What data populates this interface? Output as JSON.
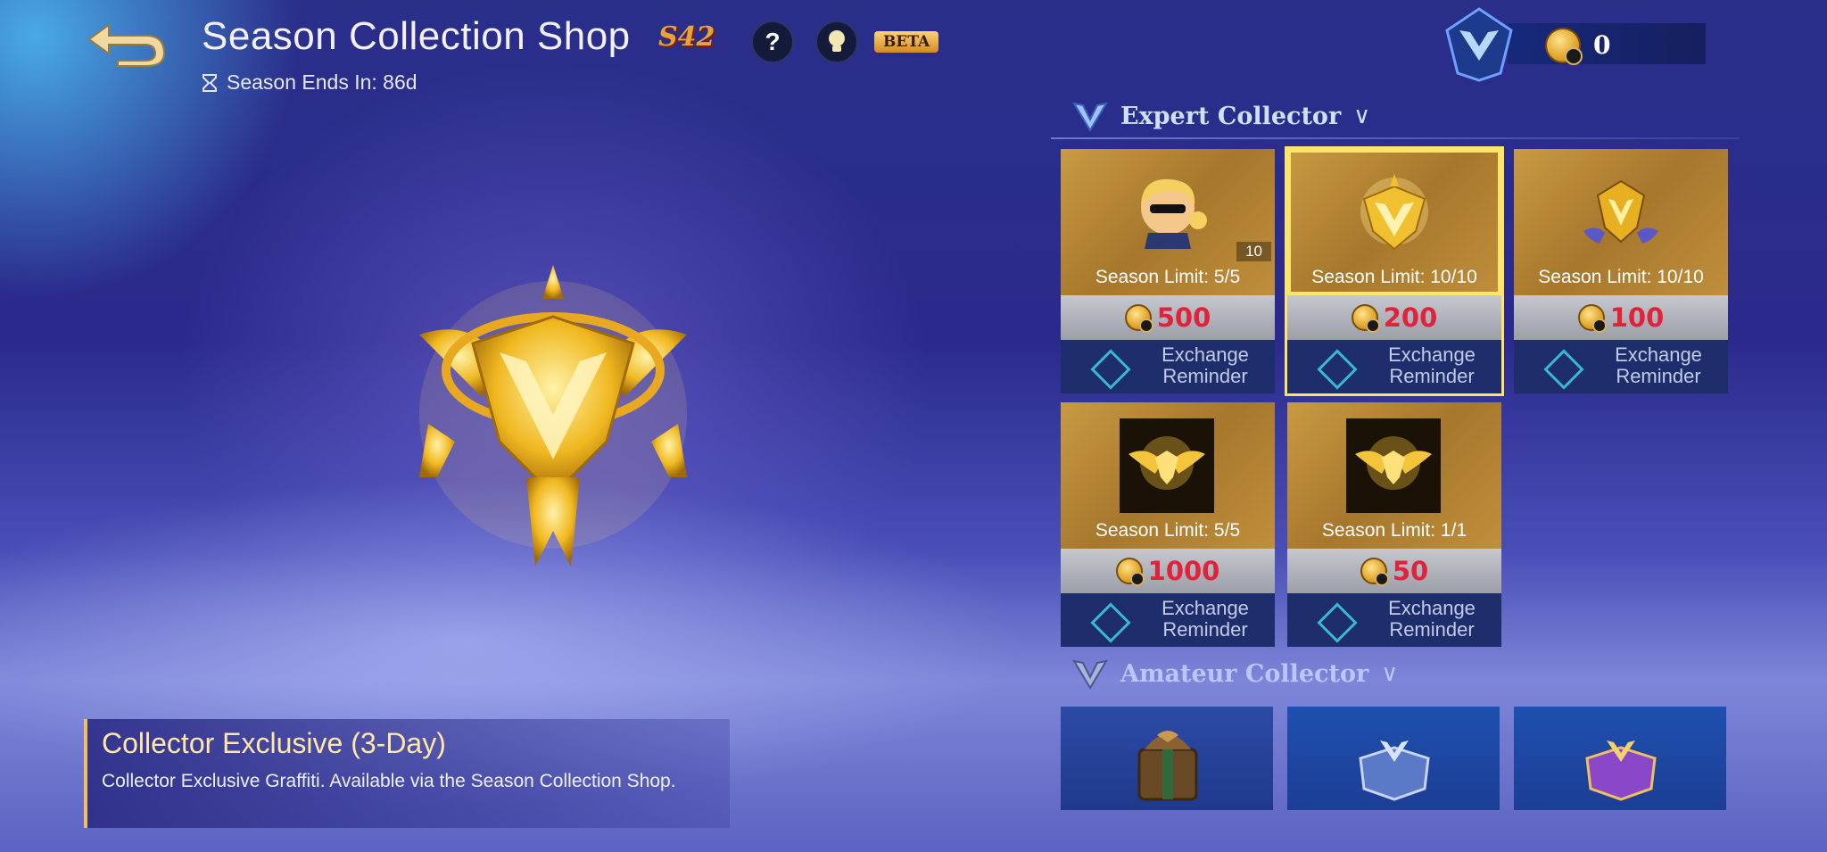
{
  "header": {
    "title": "Season Collection Shop",
    "season_badge": "S42",
    "help_label": "?",
    "beta_label": "BETA",
    "season_ends": "Season Ends In: 86d"
  },
  "currency": {
    "amount": "0"
  },
  "feature": {
    "title": "Collector Exclusive (3-Day)",
    "description": "Collector Exclusive Graffiti. Available via the Season Collection Shop."
  },
  "sections": {
    "expert": {
      "label": "Expert Collector",
      "chevron": "∨"
    },
    "amateur": {
      "label": "Amateur Collector",
      "chevron": "∨"
    }
  },
  "items": [
    {
      "icon": "hero-avatar-icon",
      "count": "10",
      "limit": "Season Limit: 5/5",
      "price": "500",
      "reminder": "Exchange Reminder"
    },
    {
      "icon": "gold-emblem-icon",
      "limit": "Season Limit: 10/10",
      "price": "200",
      "reminder": "Exchange Reminder"
    },
    {
      "icon": "winged-emblem-icon",
      "limit": "Season Limit: 10/10",
      "price": "100",
      "reminder": "Exchange Reminder"
    },
    {
      "icon": "golden-wings-icon",
      "limit": "Season Limit: 5/5",
      "price": "1000",
      "reminder": "Exchange Reminder"
    },
    {
      "icon": "golden-wings-icon",
      "limit": "Season Limit: 1/1",
      "price": "50",
      "reminder": "Exchange Reminder"
    }
  ],
  "amateur_items": [
    {
      "icon": "gift-chest-icon"
    },
    {
      "icon": "blue-chest-icon"
    },
    {
      "icon": "purple-chest-icon"
    }
  ],
  "colors": {
    "price_red": "#e0223a",
    "gold": "#c99a42",
    "highlight": "#ffe46a"
  }
}
